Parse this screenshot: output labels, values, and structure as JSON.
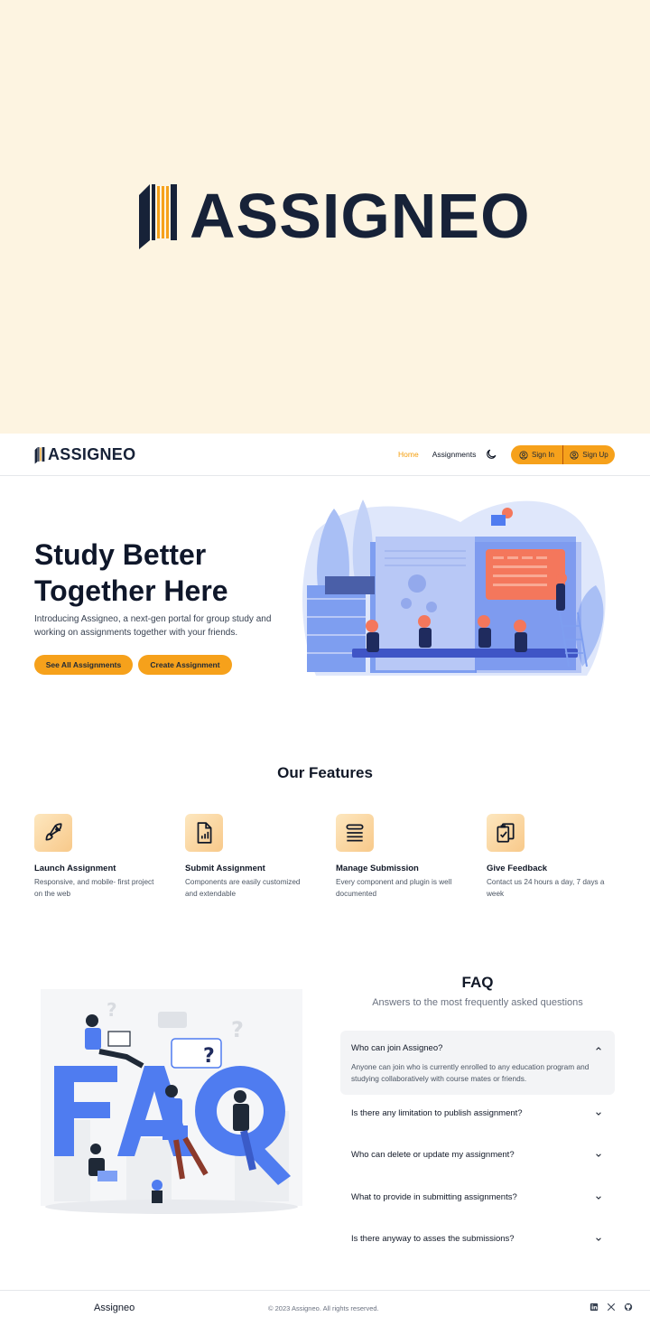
{
  "banner": {
    "logo_text": "ASSIGNEO"
  },
  "nav": {
    "logo_text": "ASSIGNEO",
    "links": [
      {
        "label": "Home",
        "active": true
      },
      {
        "label": "Assignments",
        "active": false
      }
    ],
    "theme_icon": "moon-icon",
    "sign_in": "Sign In",
    "sign_up": "Sign Up"
  },
  "hero": {
    "title_line1": "Study Better",
    "title_line2": "Together Here",
    "subtitle": "Introducing Assigneo, a next-gen portal for group study and working on assignments together with your friends.",
    "btn_all": "See All Assignments",
    "btn_create": "Create Assignment"
  },
  "features": {
    "title": "Our Features",
    "items": [
      {
        "icon": "rocket-icon",
        "title": "Launch Assignment",
        "desc": "Responsive, and mobile- first project on the web"
      },
      {
        "icon": "document-chart-icon",
        "title": "Submit Assignment",
        "desc": "Components are easily customized and extendable"
      },
      {
        "icon": "stack-icon",
        "title": "Manage Submission",
        "desc": "Every component and plugin is well documented"
      },
      {
        "icon": "clipboard-check-icon",
        "title": "Give Feedback",
        "desc": "Contact us 24 hours a day, 7 days a week"
      }
    ]
  },
  "faq": {
    "title": "FAQ",
    "subtitle": "Answers to the most frequently asked questions",
    "items": [
      {
        "q": "Who can join Assigneo?",
        "a": "Anyone can join who is currently enrolled to any education program and studying collaboratively with course mates or friends.",
        "open": true
      },
      {
        "q": "Is there any limitation to publish assignment?",
        "open": false
      },
      {
        "q": "Who can delete or update my assignment?",
        "open": false
      },
      {
        "q": "What to provide in submitting assignments?",
        "open": false
      },
      {
        "q": "Is there anyway to asses the submissions?",
        "open": false
      }
    ]
  },
  "footer": {
    "brand": "Assigneo",
    "copyright": "© 2023 Assigneo. All rights reserved.",
    "icons": [
      "linkedin-icon",
      "x-icon",
      "github-icon"
    ]
  },
  "colors": {
    "accent": "#f6a11b",
    "navy": "#172238",
    "banner_bg": "#fdf4e1",
    "illus_blue": "#4f7cf0",
    "illus_coral": "#f4775c"
  }
}
